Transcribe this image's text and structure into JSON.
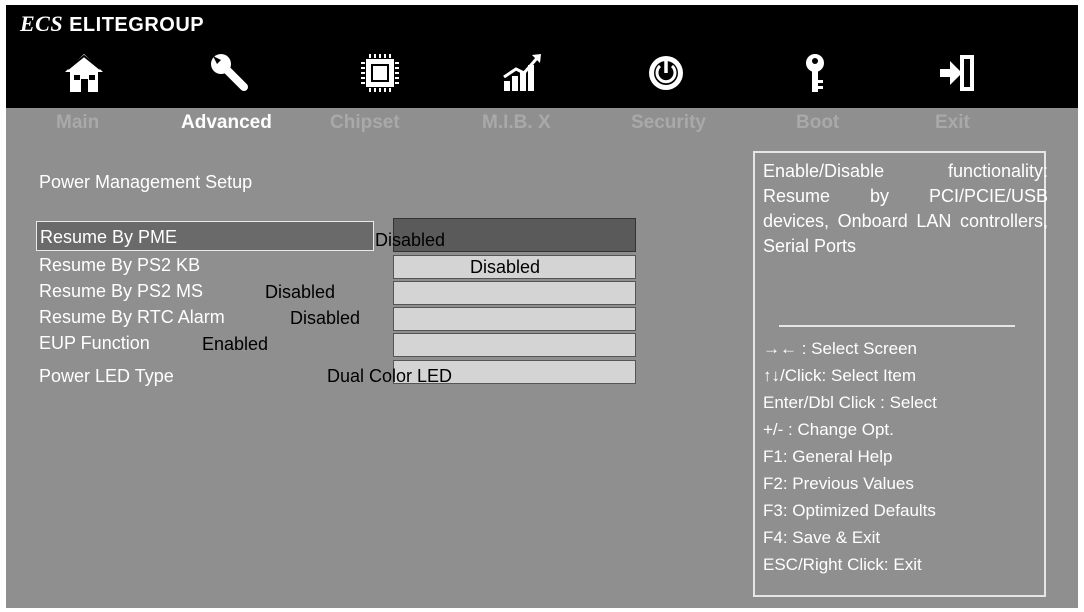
{
  "brand": {
    "mark": "ECS",
    "name": "ELITEGROUP"
  },
  "icons": [
    "home-icon",
    "wrench-icon",
    "chip-icon",
    "chart-icon",
    "power-icon",
    "key-icon",
    "exit-icon"
  ],
  "tabs": [
    {
      "label": "Main",
      "active": false
    },
    {
      "label": "Advanced",
      "active": true
    },
    {
      "label": "Chipset",
      "active": false
    },
    {
      "label": "M.I.B. X",
      "active": false
    },
    {
      "label": "Security",
      "active": false
    },
    {
      "label": "Boot",
      "active": false
    },
    {
      "label": "Exit",
      "active": false
    }
  ],
  "section_title": "Power Management Setup",
  "settings": [
    {
      "label": "Resume By  PME",
      "value": "Disabled"
    },
    {
      "label": "Resume By  PS2 KB",
      "value": "Disabled"
    },
    {
      "label": "Resume By  PS2 MS",
      "value": "Disabled"
    },
    {
      "label": "Resume By RTC Alarm",
      "value": "Disabled"
    },
    {
      "label": "EUP Function",
      "value": "Enabled"
    },
    {
      "label": "Power LED Type",
      "value": "Dual Color LED"
    }
  ],
  "help": {
    "description": "Enable/Disable functionality: Resume by PCI/PCIE/USB devices, Onboard LAN controllers, Serial Ports",
    "keys": [
      "→←  : Select Screen",
      "↑↓/Click: Select Item",
      "Enter/Dbl Click : Select",
      "+/- : Change Opt.",
      "F1: General Help",
      "F2: Previous Values",
      "F3: Optimized Defaults",
      "F4: Save & Exit",
      "ESC/Right Click: Exit"
    ]
  },
  "colors": {
    "background": "#8f8f8f",
    "topbar": "#000000",
    "active_tab": "#ffffff",
    "inactive_tab": "#a9a9a9",
    "value_box": "#d4d4d4"
  }
}
